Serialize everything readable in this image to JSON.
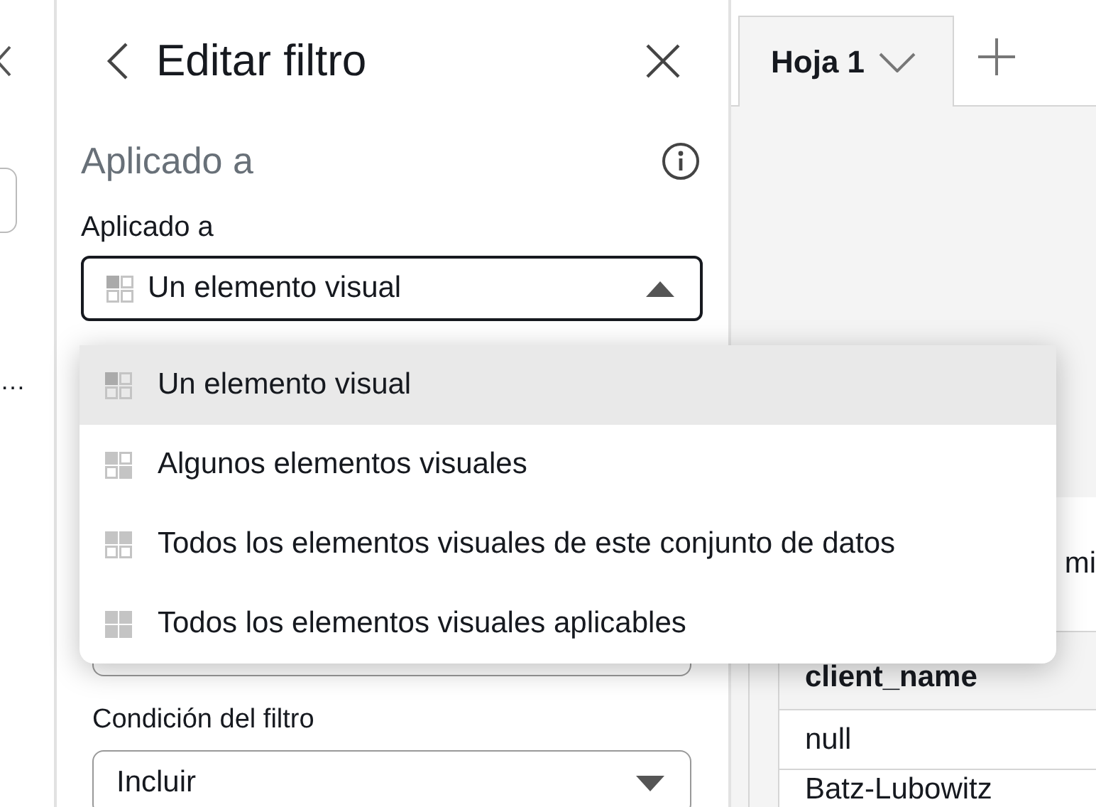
{
  "side_strip": {
    "more": "…"
  },
  "panel": {
    "title": "Editar filtro",
    "section": "Aplicado a",
    "field_label": "Aplicado a",
    "select": {
      "value": "Un elemento visual",
      "kind": "one",
      "expanded": true
    },
    "options": [
      {
        "label": "Un elemento visual",
        "kind": "one",
        "selected": true
      },
      {
        "label": "Algunos elementos visuales",
        "kind": "some",
        "selected": false
      },
      {
        "label": "Todos los elementos visuales de este conjunto de datos",
        "kind": "dataset",
        "selected": false
      },
      {
        "label": "Todos los elementos visuales aplicables",
        "kind": "all",
        "selected": false
      }
    ],
    "condition_label": "Condición del filtro",
    "condition_select": {
      "value": "Incluir"
    }
  },
  "sheet_tabs": [
    {
      "label": "Hoja 1",
      "selected": true
    }
  ],
  "table": {
    "column_text": "mi",
    "header": "client_name",
    "rows": [
      "null",
      "Batz-Lubowitz"
    ]
  }
}
